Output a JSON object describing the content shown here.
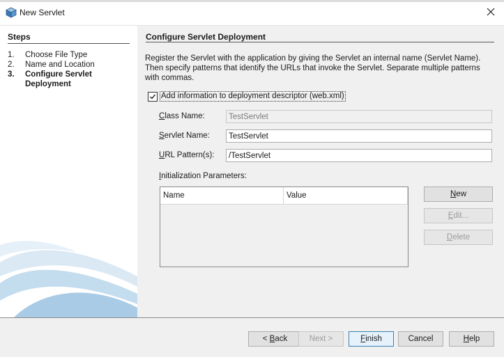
{
  "window": {
    "title": "New Servlet"
  },
  "steps": {
    "title": "Steps",
    "items": [
      {
        "num": "1.",
        "label": "Choose File Type",
        "active": false
      },
      {
        "num": "2.",
        "label": "Name and Location",
        "active": false
      },
      {
        "num": "3.",
        "label": "Configure Servlet Deployment",
        "active": true
      }
    ]
  },
  "main": {
    "title": "Configure Servlet Deployment",
    "description": "Register the Servlet with the application by giving the Servlet an internal name (Servlet Name). Then specify patterns that identify the URLs that invoke the Servlet. Separate multiple patterns with commas.",
    "add_info_checkbox": {
      "label": "Add information to deployment descriptor (web.xml)",
      "checked": true
    },
    "fields": {
      "class_name": {
        "label_mn": "C",
        "label_rest": "lass Name:",
        "value": "TestServlet",
        "disabled": true
      },
      "servlet_name": {
        "label_mn": "S",
        "label_rest": "ervlet Name:",
        "value": "TestServlet"
      },
      "url_pattern": {
        "label_mn": "U",
        "label_rest": "RL Pattern(s):",
        "value": "/TestServlet"
      }
    },
    "init_params": {
      "label_mn": "I",
      "label_rest": "nitialization Parameters:",
      "columns": [
        "Name",
        "Value"
      ],
      "rows": []
    },
    "side_buttons": {
      "new": {
        "mn": "N",
        "rest": "ew",
        "enabled": true
      },
      "edit": {
        "mn": "E",
        "rest": "dit...",
        "enabled": false
      },
      "delete": {
        "mn": "D",
        "rest": "elete",
        "enabled": false
      }
    }
  },
  "footer": {
    "back": {
      "pre": "< ",
      "mn": "B",
      "rest": "ack",
      "enabled": true
    },
    "next": {
      "label": "Next >",
      "enabled": false
    },
    "finish": {
      "mn": "F",
      "rest": "inish",
      "enabled": true,
      "focused": true
    },
    "cancel": {
      "label": "Cancel",
      "enabled": true
    },
    "help": {
      "mn": "H",
      "rest": "elp",
      "enabled": true
    }
  },
  "icons": {
    "app": "netbeans-cube-icon",
    "close": "close-icon",
    "check": "checkmark-icon"
  },
  "colors": {
    "content_bg": "#f0f0f0",
    "steps_bg": "#ffffff",
    "swoosh": "#8fb8d8",
    "focus_border": "#3c7fb1"
  }
}
